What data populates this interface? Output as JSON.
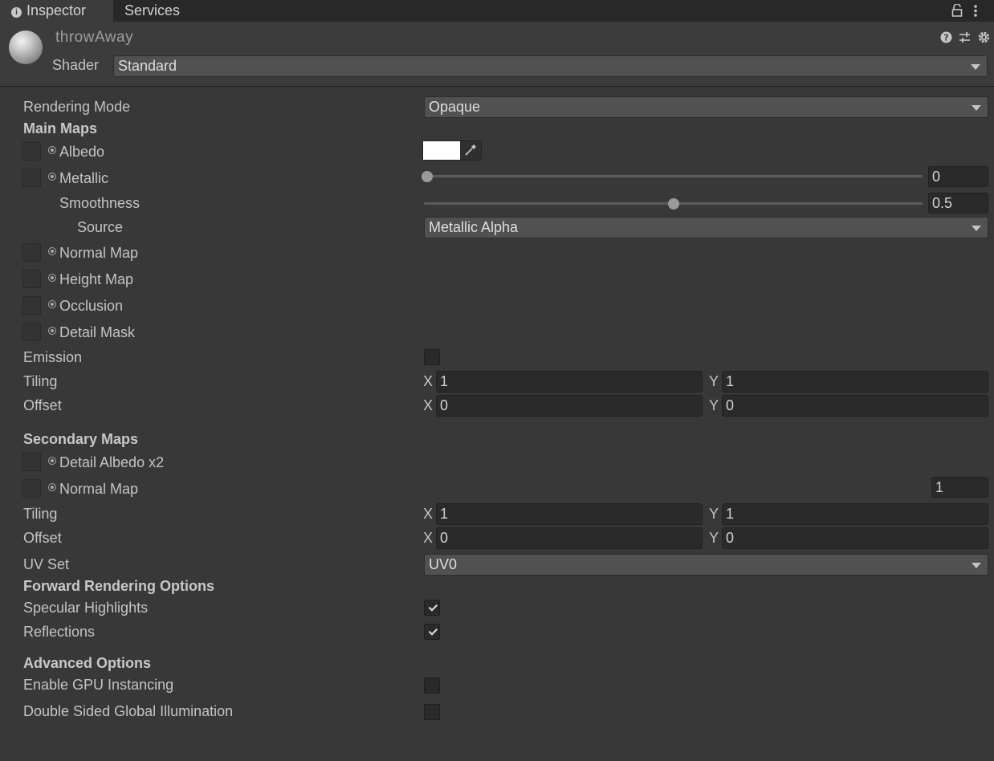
{
  "tabs": [
    {
      "label": "Inspector",
      "icon": "info-icon"
    },
    {
      "label": "Services"
    }
  ],
  "header": {
    "material_name": "throwAway",
    "shader_label": "Shader",
    "shader_value": "Standard"
  },
  "rendering_mode": {
    "label": "Rendering Mode",
    "value": "Opaque"
  },
  "main_maps": {
    "title": "Main Maps",
    "albedo": {
      "label": "Albedo",
      "color": "#ffffff"
    },
    "metallic": {
      "label": "Metallic",
      "value": "0",
      "fraction": 0.0
    },
    "smoothness": {
      "label": "Smoothness",
      "value": "0.5",
      "fraction": 0.5
    },
    "source": {
      "label": "Source",
      "value": "Metallic Alpha"
    },
    "normal_map": {
      "label": "Normal Map"
    },
    "height_map": {
      "label": "Height Map"
    },
    "occlusion": {
      "label": "Occlusion"
    },
    "detail_mask": {
      "label": "Detail Mask"
    },
    "emission": {
      "label": "Emission",
      "checked": false
    },
    "tiling": {
      "label": "Tiling",
      "x": "1",
      "y": "1"
    },
    "offset": {
      "label": "Offset",
      "x": "0",
      "y": "0"
    }
  },
  "secondary_maps": {
    "title": "Secondary Maps",
    "detail_albedo": {
      "label": "Detail Albedo x2"
    },
    "normal_map": {
      "label": "Normal Map",
      "scale": "1"
    },
    "tiling": {
      "label": "Tiling",
      "x": "1",
      "y": "1"
    },
    "offset": {
      "label": "Offset",
      "x": "0",
      "y": "0"
    },
    "uv_set": {
      "label": "UV Set",
      "value": "UV0"
    }
  },
  "forward_rendering": {
    "title": "Forward Rendering Options",
    "specular_highlights": {
      "label": "Specular Highlights",
      "checked": true
    },
    "reflections": {
      "label": "Reflections",
      "checked": true
    }
  },
  "advanced": {
    "title": "Advanced Options",
    "gpu_instancing": {
      "label": "Enable GPU Instancing",
      "checked": false
    },
    "double_sided_gi": {
      "label": "Double Sided Global Illumination",
      "checked": false
    }
  },
  "axis_labels": {
    "x": "X",
    "y": "Y"
  }
}
